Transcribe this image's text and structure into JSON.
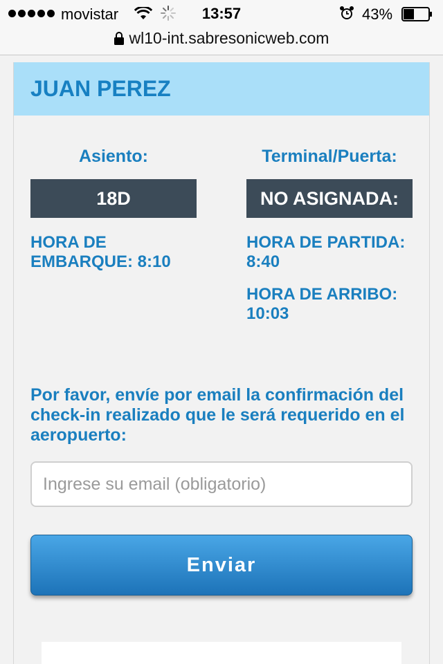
{
  "status_bar": {
    "carrier": "movistar",
    "time": "13:57",
    "battery_percent": "43%",
    "battery_level": 0.43,
    "icons": [
      "signal-dots-icon",
      "wifi-icon",
      "loading-spinner-icon",
      "alarm-icon",
      "battery-icon"
    ]
  },
  "address_bar": {
    "url": "wl10-int.sabresonicweb.com",
    "icon": "lock-icon"
  },
  "passenger": {
    "name": "JUAN PEREZ"
  },
  "seat": {
    "label": "Asiento:",
    "value": "18D"
  },
  "gate": {
    "label": "Terminal/Puerta:",
    "value": "NO ASIGNADA:"
  },
  "times": {
    "boarding": "HORA DE EMBARQUE: 8:10",
    "departure": "HORA DE PARTIDA: 8:40",
    "arrival": "HORA DE ARRIBO: 10:03"
  },
  "email_form": {
    "message": "Por favor, envíe por email la confirmación del check-in realizado que le será requerido en el aeropuerto:",
    "placeholder": "Ingrese su email (obligatorio)",
    "value": "",
    "submit_label": "Enviar"
  },
  "colors": {
    "header_bg": "#aadff9",
    "accent_text": "#1a7fbf",
    "box_bg": "#3c4b58",
    "button_top": "#49a6e6",
    "button_bottom": "#1d73b8",
    "page_bg": "#f2f2f2"
  }
}
